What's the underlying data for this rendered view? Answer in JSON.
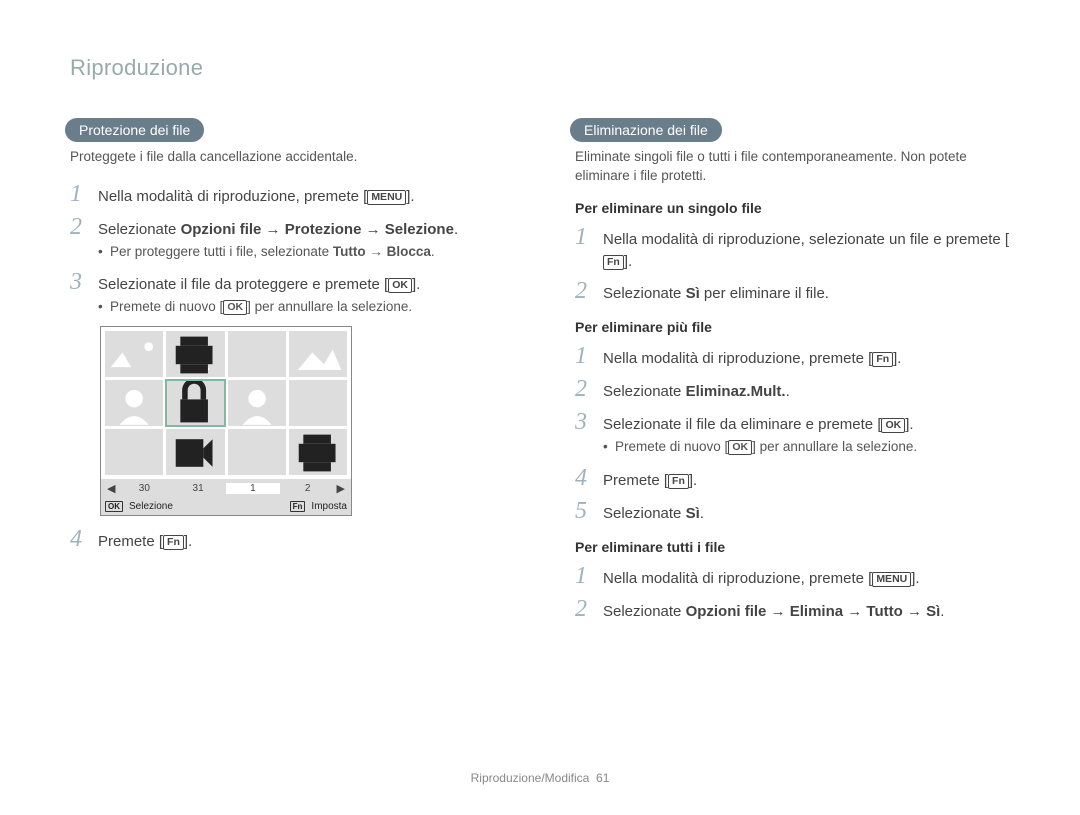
{
  "page": {
    "title": "Riproduzione",
    "footer_section": "Riproduzione/Modifica",
    "footer_page": "61"
  },
  "left": {
    "heading": "Protezione dei file",
    "desc": "Proteggete i file dalla cancellazione accidentale.",
    "steps": {
      "s1_text1": "Nella modalità di riproduzione, premete [",
      "s1_btn": "MENU",
      "s1_text2": "].",
      "s2_text1": "Selezionate ",
      "s2_bold": "Opzioni file → Protezione → Selezione",
      "s2_text2": ".",
      "s2_bullet1": "Per proteggere tutti i file, selezionate ",
      "s2_bullet_bold": "Tutto → Blocca",
      "s2_bullet2": ".",
      "s3_text1": "Selezionate il file da proteggere e premete [",
      "s3_btn": "OK",
      "s3_text2": "].",
      "s3_bullet1": "Premete di nuovo [",
      "s3_bullet_btn": "OK",
      "s3_bullet2": "] per annullare la selezione.",
      "s4_text1": "Premete [",
      "s4_btn": "Fn",
      "s4_text2": "]."
    },
    "thumb": {
      "days": [
        "30",
        "31",
        "1",
        "2"
      ],
      "status_ok": "OK",
      "status_sel": "Selezione",
      "status_fn": "Fn",
      "status_set": "Imposta"
    }
  },
  "right": {
    "heading": "Eliminazione dei file",
    "desc": "Eliminate singoli file o tutti i file contemporaneamente. Non potete eliminare i file protetti.",
    "sub1": "Per eliminare un singolo file",
    "sub1_steps": {
      "s1_text1": "Nella modalità di riproduzione, selezionate un file e premete [",
      "s1_btn": "Fn",
      "s1_text2": "].",
      "s2_text1": "Selezionate ",
      "s2_bold": "Sì",
      "s2_text2": " per eliminare il file."
    },
    "sub2": "Per eliminare più file",
    "sub2_steps": {
      "s1_text1": "Nella modalità di riproduzione, premete [",
      "s1_btn": "Fn",
      "s1_text2": "].",
      "s2_text1": "Selezionate ",
      "s2_bold": "Eliminaz.Mult.",
      "s2_text2": ".",
      "s3_text1": "Selezionate il file da eliminare e premete [",
      "s3_btn": "OK",
      "s3_text2": "].",
      "s3_bullet1": "Premete di nuovo [",
      "s3_bullet_btn": "OK",
      "s3_bullet2": "] per annullare la selezione.",
      "s4_text1": "Premete [",
      "s4_btn": "Fn",
      "s4_text2": "].",
      "s5_text1": "Selezionate ",
      "s5_bold": "Sì",
      "s5_text2": "."
    },
    "sub3": "Per eliminare tutti i file",
    "sub3_steps": {
      "s1_text1": "Nella modalità di riproduzione, premete [",
      "s1_btn": "MENU",
      "s1_text2": "].",
      "s2_text1": "Selezionate ",
      "s2_bold": "Opzioni file → Elimina → Tutto → Sì",
      "s2_text2": "."
    }
  }
}
